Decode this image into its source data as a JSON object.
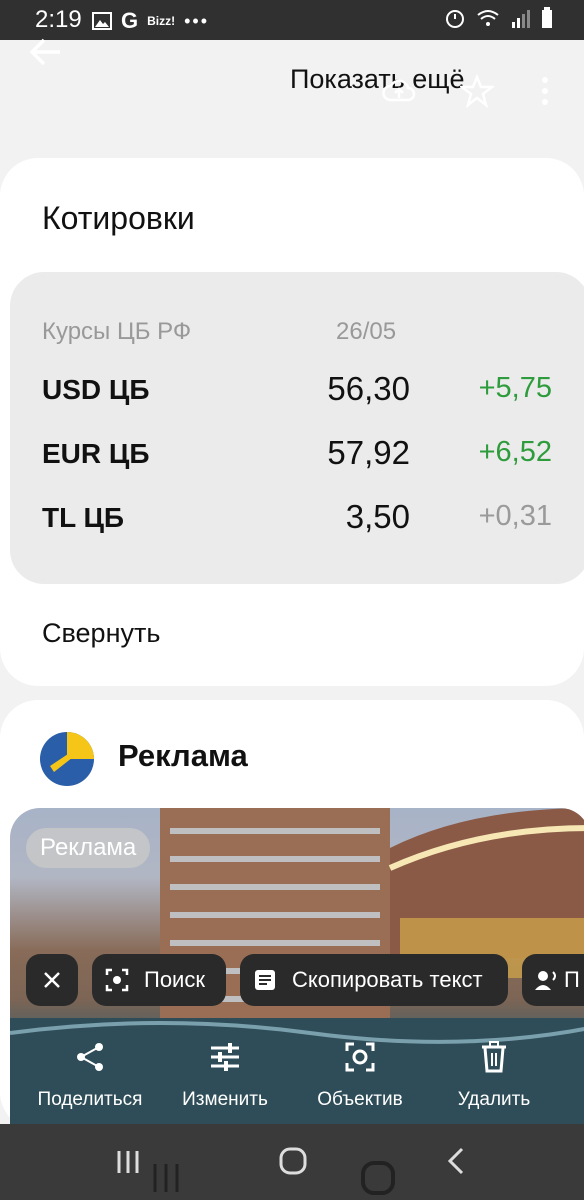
{
  "status_bar": {
    "time": "2:19",
    "badge": "Bizz!"
  },
  "header": {
    "title": "Показать ещё"
  },
  "quotes": {
    "title": "Котировки",
    "source": "Курсы ЦБ РФ",
    "date": "26/05",
    "rows": [
      {
        "name": "USD ЦБ",
        "value": "56,30",
        "change": "+5,75",
        "change_color": "#2e9c3c"
      },
      {
        "name": "EUR ЦБ",
        "value": "57,92",
        "change": "+6,52",
        "change_color": "#2e9c3c"
      },
      {
        "name": "TL ЦБ",
        "value": "3,50",
        "change": "+0,31",
        "change_color": "#9a9a9a"
      }
    ],
    "collapse_label": "Свернуть"
  },
  "ad": {
    "title": "Реклама",
    "badge": "Реклама"
  },
  "lens_chips": {
    "search": "Поиск",
    "copy": "Скопировать текст",
    "listen": "П"
  },
  "actions": {
    "share": "Поделиться",
    "edit": "Изменить",
    "lens": "Объектив",
    "delete": "Удалить"
  },
  "colors": {
    "accent_yellow": "#f5c518",
    "accent_blue": "#2a5ea8",
    "status_bar_bg": "#303030"
  }
}
